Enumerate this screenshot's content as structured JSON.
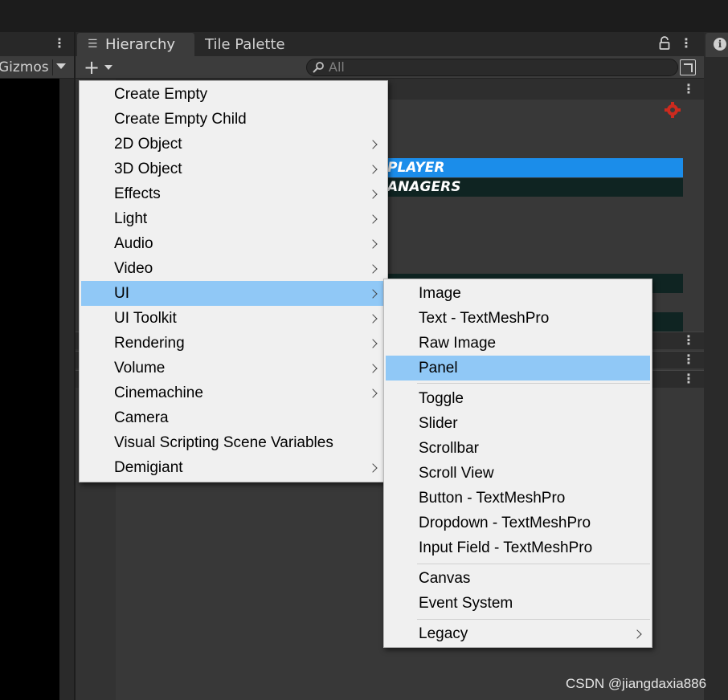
{
  "scene_panel": {
    "gizmos_label": "Gizmos"
  },
  "hierarchy": {
    "tabs": [
      {
        "label": "Hierarchy",
        "active": true
      },
      {
        "label": "Tile Palette",
        "active": false
      }
    ],
    "search_placeholder": "All",
    "rows": {
      "player": "PLAYER",
      "managers": "ANAGERS"
    },
    "accent_selected": "#1b8dea",
    "accent_dark_row": "#0f2422"
  },
  "context_menu": {
    "items": [
      {
        "label": "Create Empty",
        "submenu": false
      },
      {
        "label": "Create Empty Child",
        "submenu": false
      },
      {
        "label": "2D Object",
        "submenu": true
      },
      {
        "label": "3D Object",
        "submenu": true
      },
      {
        "label": "Effects",
        "submenu": true
      },
      {
        "label": "Light",
        "submenu": true
      },
      {
        "label": "Audio",
        "submenu": true
      },
      {
        "label": "Video",
        "submenu": true
      },
      {
        "label": "UI",
        "submenu": true,
        "highlighted": true
      },
      {
        "label": "UI Toolkit",
        "submenu": true
      },
      {
        "label": "Rendering",
        "submenu": true
      },
      {
        "label": "Volume",
        "submenu": true
      },
      {
        "label": "Cinemachine",
        "submenu": true
      },
      {
        "label": "Camera",
        "submenu": false
      },
      {
        "label": "Visual Scripting Scene Variables",
        "submenu": false
      },
      {
        "label": "Demigiant",
        "submenu": true
      }
    ],
    "highlight_color": "#90c8f6"
  },
  "ui_submenu": {
    "groups": [
      [
        {
          "label": "Image"
        },
        {
          "label": "Text - TextMeshPro"
        },
        {
          "label": "Raw Image"
        },
        {
          "label": "Panel",
          "highlighted": true
        }
      ],
      [
        {
          "label": "Toggle"
        },
        {
          "label": "Slider"
        },
        {
          "label": "Scrollbar"
        },
        {
          "label": "Scroll View"
        },
        {
          "label": "Button - TextMeshPro"
        },
        {
          "label": "Dropdown - TextMeshPro"
        },
        {
          "label": "Input Field - TextMeshPro"
        }
      ],
      [
        {
          "label": "Canvas"
        },
        {
          "label": "Event System"
        }
      ],
      [
        {
          "label": "Legacy",
          "submenu": true
        }
      ]
    ]
  },
  "watermark": "CSDN @jiangdaxia886"
}
